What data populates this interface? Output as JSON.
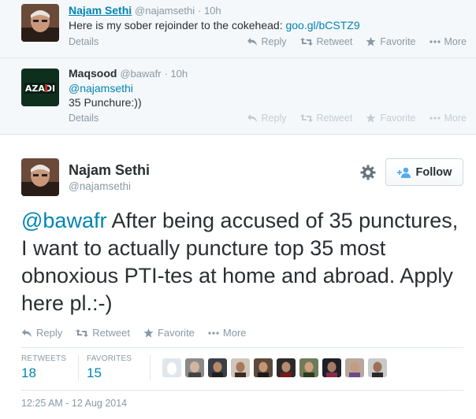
{
  "context_tweets": [
    {
      "name": "Najam Sethi",
      "handle": "@najamsethi",
      "time": "· 10h",
      "text": "Here is my sober rejoinder to the cokehead:",
      "link": "goo.gl/bCSTZ9",
      "details": "Details",
      "actions": {
        "reply": "Reply",
        "retweet": "Retweet",
        "favorite": "Favorite",
        "more": "More"
      }
    },
    {
      "name": "Maqsood",
      "handle": "@bawafr",
      "time": "· 10h",
      "avatar_text": "AZADI",
      "mention": "@najamsethi",
      "text": "35 Punchure:))",
      "details": "Details",
      "actions": {
        "reply": "Reply",
        "retweet": "Retweet",
        "favorite": "Favorite",
        "more": "More"
      }
    }
  ],
  "main_tweet": {
    "name": "Najam Sethi",
    "handle": "@najamsethi",
    "follow_label": "Follow",
    "mention": "@bawafr",
    "text": " After being accused of 35 punctures, I want to actually puncture top 35 most obnoxious PTI-tes at home and abroad. Apply here pl.:-)",
    "actions": {
      "reply": "Reply",
      "retweet": "Retweet",
      "favorite": "Favorite",
      "more": "More"
    },
    "stats": {
      "retweets_label": "RETWEETS",
      "retweets": "18",
      "favorites_label": "FAVORITES",
      "favorites": "15"
    },
    "favoriter_avatars": 10,
    "timestamp": "12:25 AM - 12 Aug 2014"
  },
  "colors": {
    "link": "#0084b4",
    "muted": "#8899a6",
    "context_bg": "#f5f8fa",
    "text": "#292f33"
  }
}
